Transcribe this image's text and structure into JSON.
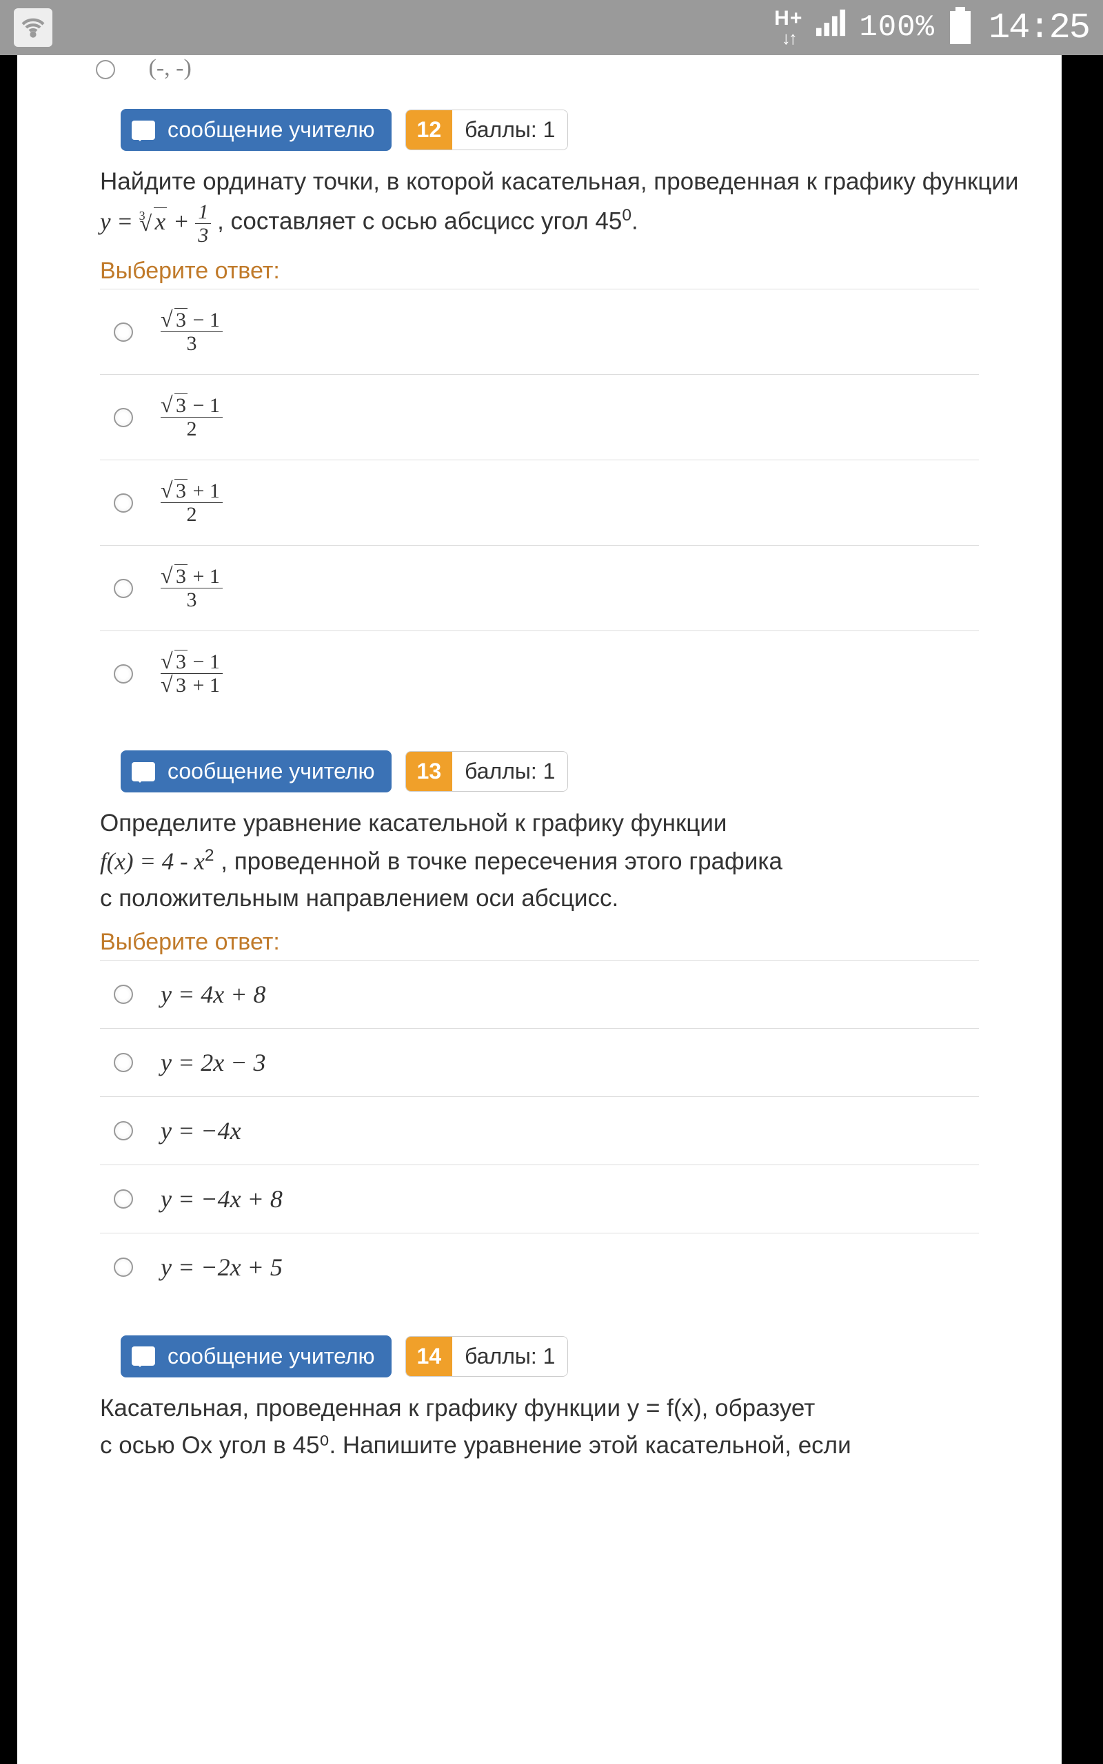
{
  "status": {
    "network": "H+",
    "battery": "100%",
    "time": "14:25"
  },
  "common": {
    "msg_teacher": "сообщение   учителю",
    "points_label": "баллы: 1",
    "choose_answer": "Выберите ответ:"
  },
  "q_prev": {
    "last_option": "(-, -)"
  },
  "q12": {
    "number": "12",
    "text_pre": "Найдите ординату точки, в которой касательная, проведенная к графику функции ",
    "formula_y": "y =",
    "formula_frac_num": "1",
    "formula_frac_den": "3",
    "text_post": ", составляет с осью абсцисс угол 45",
    "deg": "0",
    "period": ".",
    "opts": {
      "a_num_minus": "− 1",
      "a_den": "3",
      "b_num_minus": "− 1",
      "b_den": "2",
      "c_num_plus": "+ 1",
      "c_den": "2",
      "d_num_plus": "+ 1",
      "d_den": "3",
      "e_num_minus": "− 1",
      "e_den_plus": "+ 1"
    }
  },
  "q13": {
    "number": "13",
    "text1": "Определите уравнение касательной к графику функции",
    "text2a": "f(x) = 4 - x",
    "text2b": " , проведенной в точке пересечения этого графика",
    "text3": "с положительным направлением оси абсцисс.",
    "opts": {
      "a": "y = 4x + 8",
      "b": "y = 2x − 3",
      "c": "y = −4x",
      "d": "y = −4x + 8",
      "e": "y = −2x + 5"
    }
  },
  "q14": {
    "number": "14",
    "text1": "Касательная, проведенная к графику функции y = f(x), образует",
    "text2": "с осью Ox угол в 45⁰. Напишите уравнение этой касательной, если"
  }
}
